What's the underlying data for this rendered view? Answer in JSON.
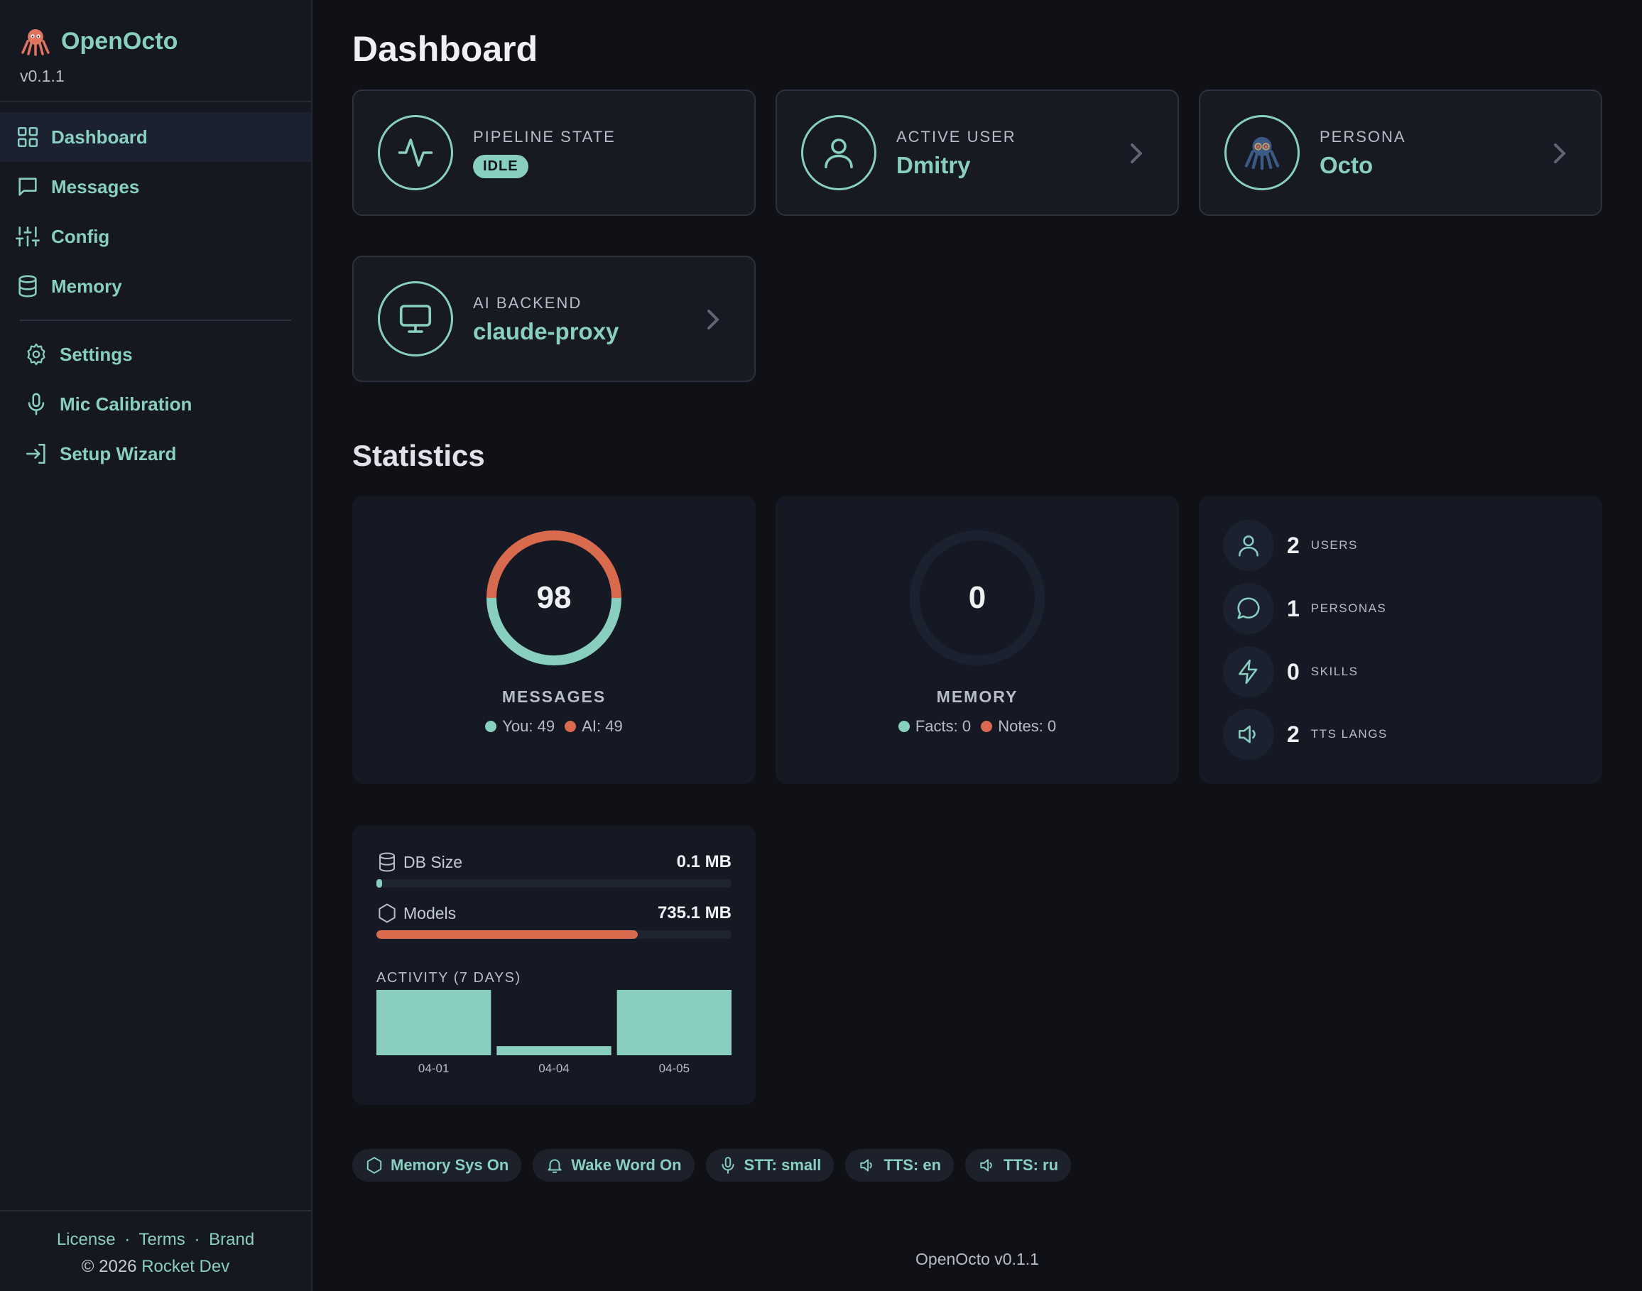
{
  "brand": {
    "name": "OpenOcto",
    "version": "v0.1.1",
    "logo_icon": "octopus-icon"
  },
  "sidebar": {
    "items": [
      {
        "label": "Dashboard",
        "icon": "grid-icon",
        "active": true
      },
      {
        "label": "Messages",
        "icon": "message-square-icon"
      },
      {
        "label": "Config",
        "icon": "sliders-icon"
      },
      {
        "label": "Memory",
        "icon": "database-icon"
      }
    ],
    "sub_items": [
      {
        "label": "Settings",
        "icon": "gear-icon"
      },
      {
        "label": "Mic Calibration",
        "icon": "microphone-icon"
      },
      {
        "label": "Setup Wizard",
        "icon": "login-arrow-icon"
      }
    ],
    "footer": {
      "links": [
        "License",
        "Terms",
        "Brand"
      ],
      "separator": "·",
      "copyright": "© 2026",
      "company": "Rocket Dev"
    }
  },
  "page": {
    "title": "Dashboard",
    "stats_title": "Statistics"
  },
  "cards": {
    "pipeline": {
      "label": "PIPELINE STATE",
      "badge": "IDLE",
      "icon": "activity-icon"
    },
    "user": {
      "label": "ACTIVE USER",
      "value": "Dmitry",
      "icon": "user-icon"
    },
    "persona": {
      "label": "PERSONA",
      "value": "Octo",
      "icon": "octopus-icon"
    },
    "backend": {
      "label": "AI BACKEND",
      "value": "claude-proxy",
      "icon": "monitor-icon"
    }
  },
  "stats": {
    "messages": {
      "total": "98",
      "title": "MESSAGES",
      "you_label": "You: 49",
      "ai_label": "AI: 49",
      "you": 49,
      "ai": 49
    },
    "memory": {
      "total": "0",
      "title": "MEMORY",
      "facts_label": "Facts: 0",
      "notes_label": "Notes: 0",
      "facts": 0,
      "notes": 0
    },
    "counts": [
      {
        "value": "2",
        "label": "USERS",
        "icon": "user-icon"
      },
      {
        "value": "1",
        "label": "PERSONAS",
        "icon": "chat-bubble-icon"
      },
      {
        "value": "0",
        "label": "SKILLS",
        "icon": "lightning-icon"
      },
      {
        "value": "2",
        "label": "TTS LANGS",
        "icon": "speaker-icon"
      }
    ]
  },
  "storage": {
    "db": {
      "label": "DB Size",
      "value": "0.1 MB",
      "fraction": 0.015
    },
    "models": {
      "label": "Models",
      "value": "735.1 MB",
      "fraction": 0.735
    }
  },
  "activity": {
    "title": "ACTIVITY (7 DAYS)",
    "chart_data": {
      "type": "bar",
      "categories": [
        "04-01",
        "04-04",
        "04-05"
      ],
      "values": [
        1.0,
        0.14,
        1.0
      ],
      "title": "ACTIVITY (7 DAYS)"
    }
  },
  "chips": [
    {
      "label": "Memory Sys On",
      "icon": "hexagon-icon"
    },
    {
      "label": "Wake Word On",
      "icon": "bell-icon"
    },
    {
      "label": "STT: small",
      "icon": "microphone-icon"
    },
    {
      "label": "TTS: en",
      "icon": "speaker-icon"
    },
    {
      "label": "TTS: ru",
      "icon": "speaker-icon"
    }
  ],
  "footer": {
    "text": "OpenOcto v0.1.1"
  },
  "colors": {
    "accent": "#88cfc2",
    "orange": "#d96a4e",
    "bg": "#0f1116",
    "panel": "#151923"
  }
}
